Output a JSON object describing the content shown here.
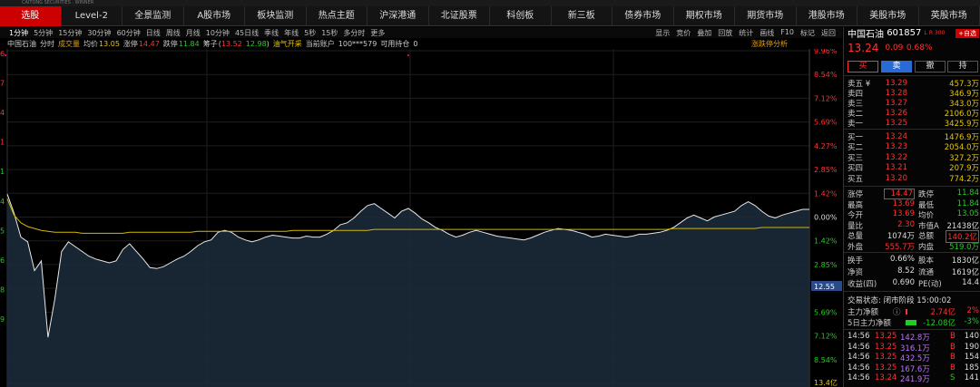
{
  "titlebar": {
    "text": "CAITONG SECURITIES · WINNER"
  },
  "nav": [
    "选股",
    "Level-2",
    "全景监测",
    "A股市场",
    "板块监测",
    "热点主题",
    "沪深港通",
    "北证股票",
    "科创板",
    "新三板",
    "债券市场",
    "期权市场",
    "期货市场",
    "港股市场",
    "美股市场",
    "英股市场"
  ],
  "toolbar": {
    "timeframes": [
      "1分钟",
      "5分钟",
      "15分钟",
      "30分钟",
      "60分钟",
      "日线",
      "周线",
      "月线",
      "10分钟",
      "45日线",
      "季线",
      "年线",
      "5秒",
      "15秒",
      "多分时",
      "更多"
    ],
    "right": [
      "显示",
      "竞价",
      "叠加",
      "回放",
      "统计",
      "画线",
      "F10",
      "标记",
      "返回"
    ]
  },
  "infobar": {
    "name": "中国石油",
    "period": "分时",
    "vol_label": "成交量",
    "avg_label": "均价",
    "avg_value": "13.05",
    "limit_up_label": "涨停",
    "limit_up_value": "14.47",
    "limit_down_label": "跌停",
    "limit_down_value": "11.84",
    "chip_label": "筹子",
    "chip_a": "13.52",
    "chip_b": "12.98",
    "sector": "油气开采",
    "account_label": "当前账户",
    "account_value": "100***579",
    "avail_label": "可用持仓",
    "avail_value": "0",
    "analysis_link": "涨跌停分析"
  },
  "chart_data": {
    "type": "line",
    "series": [
      {
        "values": [
          13.4,
          13.2,
          12.95,
          12.9,
          12.6,
          12.7,
          11.9,
          12.3,
          12.8,
          12.9,
          12.85,
          12.8,
          12.75,
          12.72,
          12.7,
          12.68,
          12.7,
          12.82,
          12.88,
          12.8,
          12.72,
          12.63,
          12.62,
          12.64,
          12.68,
          12.72,
          12.75,
          12.8,
          12.86,
          12.9,
          12.92,
          13.0,
          13.02,
          13.0,
          12.95,
          12.92,
          12.9,
          12.92,
          12.95,
          12.97,
          12.96,
          12.95,
          12.94,
          12.94,
          12.96,
          12.95,
          12.95,
          12.98,
          13.02,
          13.08,
          13.1,
          13.15,
          13.22,
          13.28,
          13.3,
          13.25,
          13.2,
          13.15,
          13.22,
          13.25,
          13.2,
          13.14,
          13.1,
          13.05,
          13.02,
          12.98,
          12.95,
          12.97,
          13.0,
          13.02,
          13.0,
          12.98,
          12.96,
          12.95,
          12.94,
          12.93,
          12.92,
          12.94,
          12.97,
          13.0,
          13.02,
          13.04,
          13.03,
          13.02,
          13.0,
          12.98,
          12.95,
          12.96,
          12.98,
          12.97,
          12.96,
          12.95,
          12.96,
          12.98,
          12.98,
          12.99,
          13.0,
          13.02,
          13.05,
          13.1,
          13.15,
          13.18,
          13.15,
          13.12,
          13.16,
          13.18,
          13.2,
          13.22,
          13.28,
          13.32,
          13.28,
          13.22,
          13.17,
          13.15,
          13.18,
          13.2,
          13.22,
          13.24,
          13.24
        ]
      },
      {
        "values": [
          13.35,
          13.18,
          13.1,
          13.06,
          13.04,
          13.02,
          13.01,
          13.0,
          13.0,
          13.0,
          13.0,
          12.99,
          12.99,
          12.99,
          12.99,
          12.99,
          12.99,
          12.99,
          13.0,
          13.0,
          13.0,
          13.0,
          13.0,
          13.0,
          13.0,
          13.0,
          13.0,
          13.0,
          13.01,
          13.01,
          13.01,
          13.01,
          13.01,
          13.01,
          13.01,
          13.01,
          13.01,
          13.01,
          13.01,
          13.01,
          13.01,
          13.01,
          13.02,
          13.02,
          13.02,
          13.02,
          13.02,
          13.02,
          13.02,
          13.02,
          13.02,
          13.02,
          13.02,
          13.02,
          13.03,
          13.03,
          13.03,
          13.03,
          13.03,
          13.03,
          13.03,
          13.03,
          13.03,
          13.03,
          13.03,
          13.03,
          13.03,
          13.03,
          13.03,
          13.03,
          13.03,
          13.03,
          13.03,
          13.03,
          13.03,
          13.03,
          13.03,
          13.03,
          13.03,
          13.03,
          13.03,
          13.03,
          13.03,
          13.03,
          13.03,
          13.03,
          13.03,
          13.03,
          13.03,
          13.03,
          13.03,
          13.03,
          13.03,
          13.03,
          13.03,
          13.03,
          13.03,
          13.03,
          13.04,
          13.04,
          13.04,
          13.04,
          13.04,
          13.04,
          13.04,
          13.04,
          13.04,
          13.04,
          13.04,
          13.04,
          13.04,
          13.05,
          13.05,
          13.05,
          13.05,
          13.05,
          13.05,
          13.05,
          13.05
        ]
      }
    ],
    "prev_close": 13.15,
    "ylim": [
      11.38,
      14.92
    ],
    "right_ticks": [
      "9.96%",
      "8.54%",
      "7.12%",
      "5.69%",
      "4.27%",
      "2.85%",
      "1.42%",
      "0.00%",
      "1.42%",
      "2.85%",
      "4.27%",
      "5.69%",
      "7.12%",
      "8.54%",
      "13.4亿"
    ],
    "left_ticks": [
      "6",
      "7",
      "4",
      "1",
      "1",
      "4",
      "5",
      "6",
      "8",
      "9"
    ],
    "cursor_price": "12.55",
    "grid": true
  },
  "quote": {
    "name": "中国石油",
    "code": "601857",
    "tag": "L R 300",
    "fav": "+自选",
    "price": "13.24",
    "change": "0.09",
    "pct": "0.68%",
    "buy": "买",
    "sell": "卖",
    "cancel": "撤",
    "hold": "持",
    "asks": [
      [
        "卖五 ¥",
        "13.29",
        "457.3万"
      ],
      [
        "卖四",
        "13.28",
        "346.9万"
      ],
      [
        "卖三",
        "13.27",
        "343.0万"
      ],
      [
        "卖二",
        "13.26",
        "2106.0万"
      ],
      [
        "卖一",
        "13.25",
        "3425.9万"
      ]
    ],
    "bids": [
      [
        "买一",
        "13.24",
        "1476.9万"
      ],
      [
        "买二",
        "13.23",
        "2054.0万"
      ],
      [
        "买三",
        "13.22",
        "327.2万"
      ],
      [
        "买四",
        "13.21",
        "207.9万"
      ],
      [
        "买五",
        "13.20",
        "774.2万"
      ]
    ],
    "stats": [
      [
        "涨停",
        "14.47",
        "跌停",
        "11.84"
      ],
      [
        "最高",
        "13.69",
        "最低",
        "11.84"
      ],
      [
        "今开",
        "13.69",
        "均价",
        "13.05"
      ],
      [
        "量比",
        "2.30",
        "市值A",
        "21438亿"
      ],
      [
        "总量",
        "1074万",
        "总额",
        "140.2亿"
      ],
      [
        "外盘",
        "555.7万",
        "内盘",
        "519.0万"
      ]
    ],
    "stats2": [
      [
        "换手",
        "0.66%",
        "股本",
        "1830亿"
      ],
      [
        "净资",
        "8.52",
        "流通",
        "1619亿"
      ],
      [
        "收益(四)",
        "0.690",
        "PE(动)",
        "14.4"
      ]
    ],
    "status": "交易状态: 闭市阶段 15:00:02",
    "flow1_label": "主力净额",
    "flow1_value": "2.74亿",
    "flow1_pct": "2%",
    "flow2_label": "5日主力净额",
    "flow2_value": "-12.08亿",
    "flow2_pct": "-3%",
    "ticks": [
      [
        "14:56",
        "13.25",
        "142.8万",
        "B",
        "140"
      ],
      [
        "14:56",
        "13.25",
        "316.1万",
        "B",
        "190"
      ],
      [
        "14:56",
        "13.25",
        "432.5万",
        "B",
        "154"
      ],
      [
        "14:56",
        "13.25",
        "167.6万",
        "B",
        "185"
      ],
      [
        "14:56",
        "13.24",
        "241.9万",
        "S",
        "141"
      ]
    ]
  }
}
